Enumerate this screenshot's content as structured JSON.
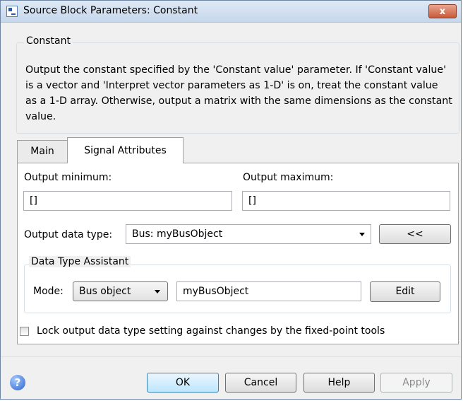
{
  "window": {
    "title": "Source Block Parameters: Constant",
    "close_label": "x"
  },
  "block": {
    "group_title": "Constant",
    "description": "Output the constant specified by the 'Constant value' parameter. If 'Constant value' is a vector and 'Interpret vector parameters as 1-D' is on, treat the constant value as a 1-D array. Otherwise, output a matrix with the same dimensions as the constant value."
  },
  "tabs": [
    {
      "label": "Main",
      "active": false
    },
    {
      "label": "Signal Attributes",
      "active": true
    }
  ],
  "signal_attributes": {
    "output_minimum_label": "Output minimum:",
    "output_minimum_value": "[]",
    "output_maximum_label": "Output maximum:",
    "output_maximum_value": "[]",
    "output_data_type_label": "Output data type:",
    "output_data_type_value": "Bus: myBusObject",
    "assistant_toggle_label": "<<",
    "assistant": {
      "group_title": "Data Type Assistant",
      "mode_label": "Mode:",
      "mode_value": "Bus object",
      "bus_object_value": "myBusObject",
      "edit_label": "Edit"
    },
    "lock_label": "Lock output data type setting against changes by the fixed-point tools",
    "lock_checked": false
  },
  "footer": {
    "help_icon_glyph": "?",
    "ok_label": "OK",
    "cancel_label": "Cancel",
    "help_label": "Help",
    "apply_label": "Apply"
  }
}
